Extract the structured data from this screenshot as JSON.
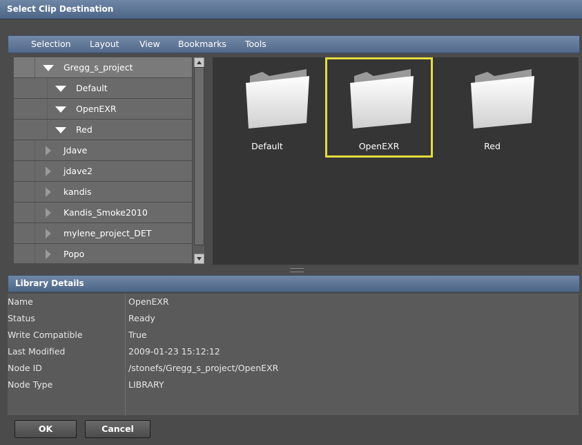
{
  "window": {
    "title": "Select Clip Destination"
  },
  "menubar": {
    "items": [
      "Selection",
      "Layout",
      "View",
      "Bookmarks",
      "Tools"
    ]
  },
  "tree": {
    "items": [
      {
        "label": "Gregg_s_project",
        "expanded": true,
        "level": 0
      },
      {
        "label": "Default",
        "expanded": true,
        "level": 1
      },
      {
        "label": "OpenEXR",
        "expanded": true,
        "level": 1
      },
      {
        "label": "Red",
        "expanded": true,
        "level": 1
      },
      {
        "label": "Jdave",
        "expanded": false,
        "level": 0
      },
      {
        "label": "jdave2",
        "expanded": false,
        "level": 0
      },
      {
        "label": "kandis",
        "expanded": false,
        "level": 0
      },
      {
        "label": "Kandis_Smoke2010",
        "expanded": false,
        "level": 0
      },
      {
        "label": "mylene_project_DET",
        "expanded": false,
        "level": 0
      },
      {
        "label": "Popo",
        "expanded": false,
        "level": 0
      }
    ]
  },
  "browser": {
    "folders": [
      {
        "label": "Default",
        "selected": false
      },
      {
        "label": "OpenEXR",
        "selected": true
      },
      {
        "label": "Red",
        "selected": false
      }
    ],
    "selection_color": "#e6dc3b"
  },
  "details": {
    "title": "Library Details",
    "rows": [
      {
        "key": "Name",
        "value": "OpenEXR"
      },
      {
        "key": "Status",
        "value": "Ready"
      },
      {
        "key": "Write Compatible",
        "value": "True"
      },
      {
        "key": "Last Modified",
        "value": "2009-01-23 15:12:12"
      },
      {
        "key": "Node ID",
        "value": "/stonefs/Gregg_s_project/OpenEXR"
      },
      {
        "key": "Node Type",
        "value": "LIBRARY"
      }
    ]
  },
  "buttons": {
    "ok": "OK",
    "cancel": "Cancel"
  }
}
